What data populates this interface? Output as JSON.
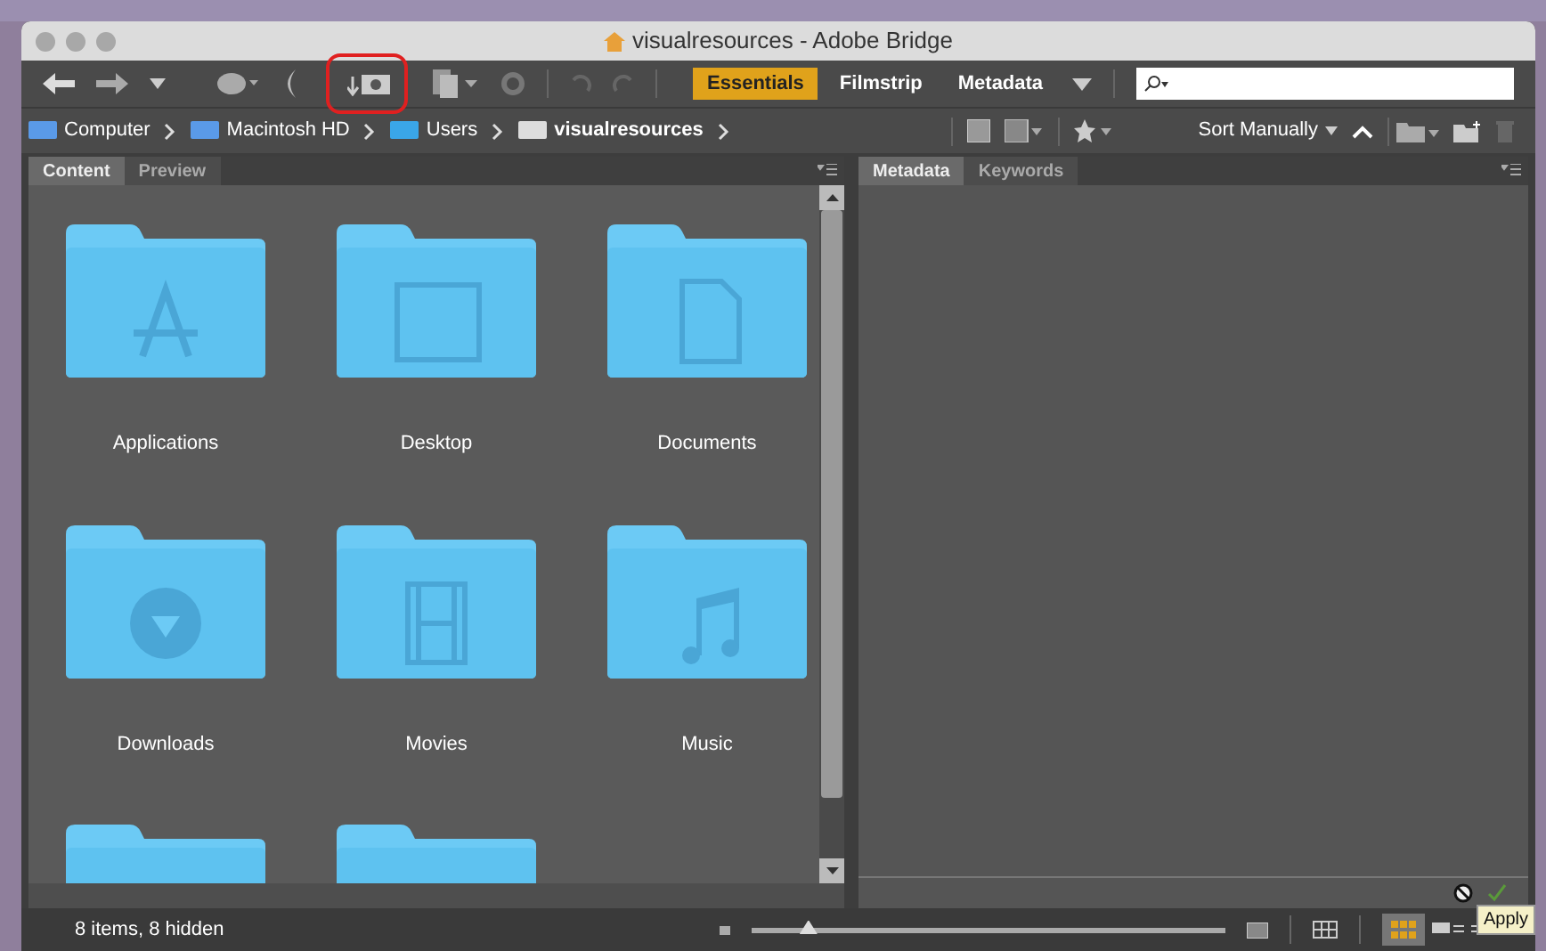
{
  "window": {
    "title": "visualresources - Adobe Bridge"
  },
  "workspaces": [
    {
      "label": "Essentials",
      "selected": true
    },
    {
      "label": "Filmstrip",
      "selected": false
    },
    {
      "label": "Metadata",
      "selected": false
    }
  ],
  "path": [
    "Computer",
    "Macintosh HD",
    "Users",
    "visualresources"
  ],
  "sort": {
    "label": "Sort Manually"
  },
  "left_panel": {
    "tabs": [
      {
        "label": "Content",
        "selected": true
      },
      {
        "label": "Preview",
        "selected": false
      }
    ]
  },
  "right_panel": {
    "tabs": [
      {
        "label": "Metadata",
        "selected": true
      },
      {
        "label": "Keywords",
        "selected": false
      }
    ]
  },
  "folders": [
    {
      "name": "Applications",
      "kind": "apps"
    },
    {
      "name": "Desktop",
      "kind": "desktop"
    },
    {
      "name": "Documents",
      "kind": "document"
    },
    {
      "name": "Downloads",
      "kind": "download"
    },
    {
      "name": "Movies",
      "kind": "film"
    },
    {
      "name": "Music",
      "kind": "music"
    },
    {
      "kind": "plain"
    },
    {
      "kind": "plain"
    }
  ],
  "thumbnail_slider": {
    "level": 0.12
  },
  "status_bar": {
    "text": "8 items, 8 hidden"
  },
  "tooltip": "Apply"
}
